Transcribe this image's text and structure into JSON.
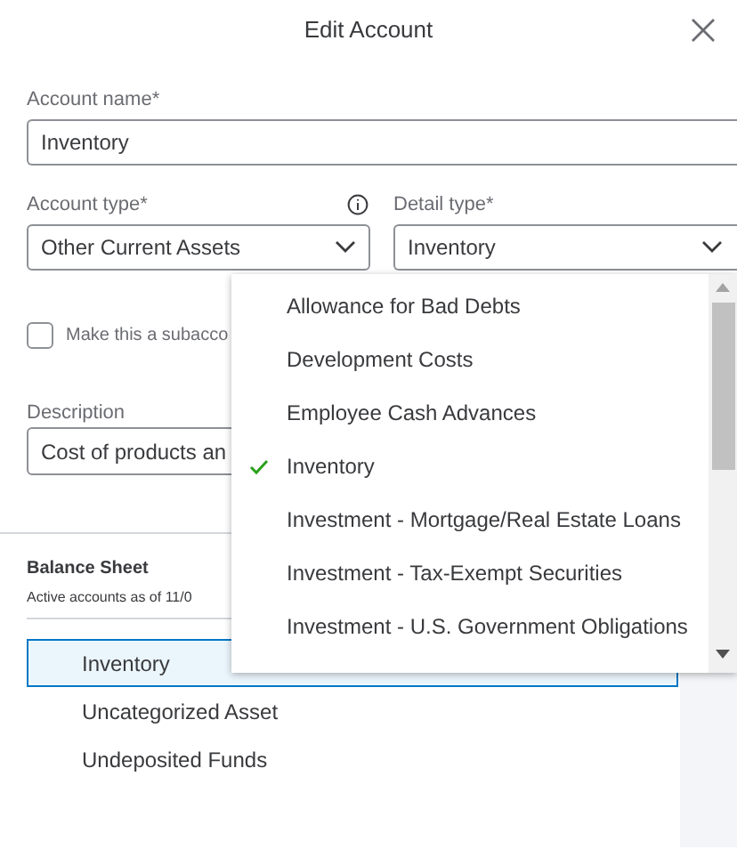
{
  "dialog": {
    "title": "Edit Account"
  },
  "account_name": {
    "label": "Account name*",
    "value": "Inventory"
  },
  "account_type": {
    "label": "Account type*",
    "value": "Other Current Assets"
  },
  "detail_type": {
    "label": "Detail type*",
    "value": "Inventory",
    "expanded": true
  },
  "subaccount": {
    "label": "Make this a subacco",
    "checked": false
  },
  "description": {
    "label": "Description",
    "value": "Cost of products an"
  },
  "detail_options": [
    {
      "label": "Allowance for Bad Debts",
      "selected": false
    },
    {
      "label": "Development Costs",
      "selected": false
    },
    {
      "label": "Employee Cash Advances",
      "selected": false
    },
    {
      "label": "Inventory",
      "selected": true
    },
    {
      "label": "Investment - Mortgage/Real Estate Loans",
      "selected": false
    },
    {
      "label": "Investment - Tax-Exempt Securities",
      "selected": false
    },
    {
      "label": "Investment - U.S. Government Obligations",
      "selected": false
    }
  ],
  "balance_sheet": {
    "title": "Balance Sheet",
    "subtitle": "Active accounts as of 11/0",
    "accounts": [
      {
        "label": "Inventory",
        "selected": true
      },
      {
        "label": "Uncategorized Asset",
        "selected": false
      },
      {
        "label": "Undeposited Funds",
        "selected": false
      }
    ]
  }
}
